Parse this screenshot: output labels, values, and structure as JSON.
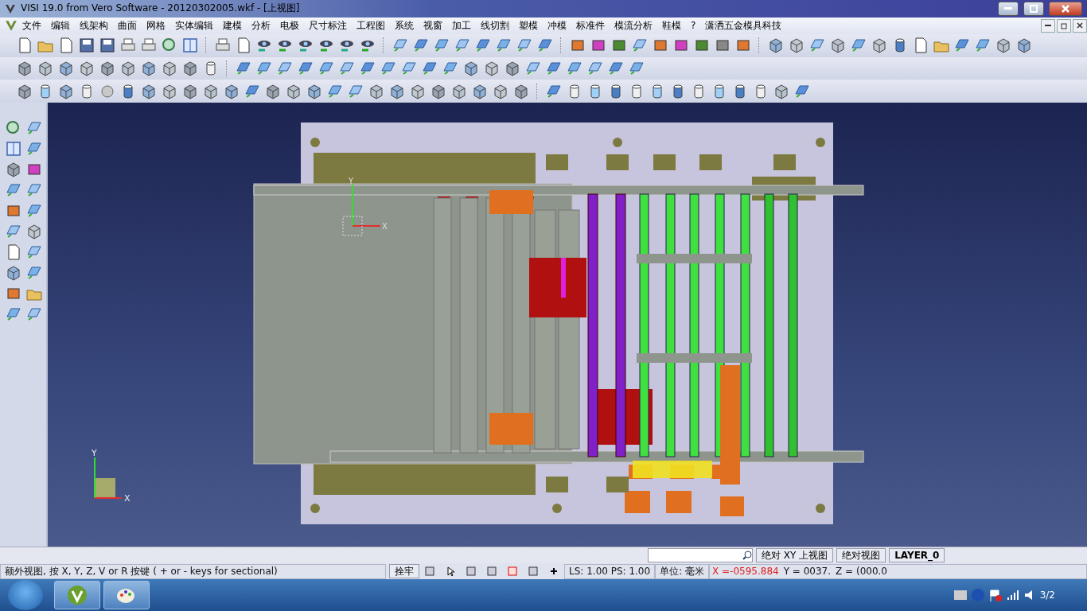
{
  "window": {
    "title": "VISI 19.0  from Vero Software - 20120302005.wkf - [上视图]"
  },
  "menu": [
    "文件",
    "编辑",
    "线架构",
    "曲面",
    "网格",
    "实体编辑",
    "建模",
    "分析",
    "电极",
    "尺寸标注",
    "工程图",
    "系统",
    "视窗",
    "加工",
    "线切割",
    "塑模",
    "冲模",
    "标准件",
    "模流分析",
    "鞋模",
    "?",
    "潇洒五金模具科技"
  ],
  "viewport": {
    "model_axes": {
      "x": "X",
      "y": "Y"
    },
    "triad": {
      "x": "X",
      "y": "Y"
    }
  },
  "status_bar": {
    "view_buttons": [
      "绝对 XY 上视图",
      "绝对视图",
      "LAYER_0"
    ],
    "message": "额外视图, 按 X, Y, Z, V or R 按键 ( + or - keys for sectional)",
    "snap": "拴牢",
    "scale": "LS: 1.00 PS: 1.00",
    "units": "单位: 毫米",
    "x": "X =-0595.884",
    "y": "Y = 0037.",
    "z": "Z = (000.0"
  },
  "taskbar": {
    "clock": "3/2"
  }
}
